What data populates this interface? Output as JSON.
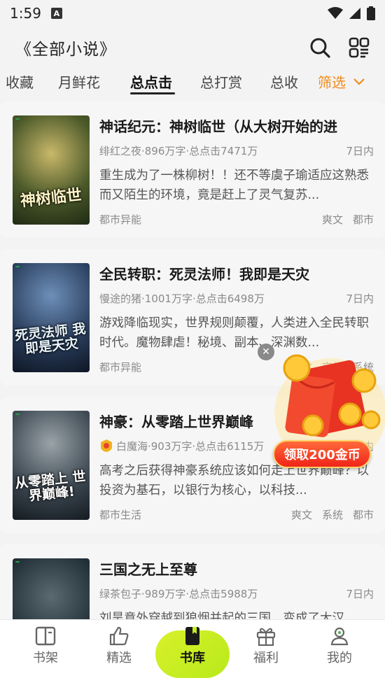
{
  "status_bar": {
    "time": "1:59",
    "notification_icon": "A"
  },
  "header": {
    "title": "《全部小说》",
    "icons": [
      "search-icon",
      "scan-icon"
    ]
  },
  "tabs": [
    {
      "label": "收藏"
    },
    {
      "label": "月鲜花"
    },
    {
      "label": "总点击"
    },
    {
      "label": "总打赏"
    },
    {
      "label": "总收"
    }
  ],
  "active_tab": "总点击",
  "filter_label": "筛选",
  "books": [
    {
      "title": "神话纪元：神树临世（从大树开始的进",
      "meta": "绯红之夜·896万字·总点击7471万",
      "time": "7日内",
      "desc": "重生成为了一株柳树！！还不等虞子瑜适应这熟悉而又陌生的环境，竟是赶上了灵气复苏...",
      "category": "都市异能",
      "tags": [
        "爽文",
        "都市"
      ],
      "cover_text": "神树临世"
    },
    {
      "title": "全民转职：死灵法师！我即是天灾",
      "meta": "慢途的猪·1001万字·总点击6498万",
      "time": "7日内",
      "desc": "游戏降临现实，世界规则颠覆，人类进入全民转职时代。魔物肆虐！秘境、副本、深渊数...",
      "category": "都市异能",
      "tags": [
        "爽文",
        "穿越",
        "系统"
      ],
      "cover_text": "死灵法师 我即是天灾"
    },
    {
      "title": "神豪：从零踏上世界巅峰",
      "meta": "白魔海·903万字·总点击6115万",
      "time": "7日内",
      "desc": "高考之后获得神豪系统应该如何走上世界巅峰？以投资为基石，以银行为核心，以科技...",
      "category": "都市生活",
      "tags": [
        "爽文",
        "系统",
        "都市"
      ],
      "cover_text": "从零踏上 世界巅峰!"
    },
    {
      "title": "三国之无上至尊",
      "meta": "绿茶包子·989万字·总点击5988万",
      "time": "7日内",
      "desc": "刘昊意外穿越到狼烟并起的三国，变成了大汉...",
      "category": "",
      "tags": [],
      "cover_text": ""
    }
  ],
  "promo": {
    "button_label": "领取200金币"
  },
  "bottom_nav": [
    {
      "label": "书架",
      "icon": "bookshelf-icon"
    },
    {
      "label": "精选",
      "icon": "thumbs-up-icon"
    },
    {
      "label": "书库",
      "icon": "library-icon"
    },
    {
      "label": "福利",
      "icon": "gift-icon"
    },
    {
      "label": "我的",
      "icon": "profile-icon"
    }
  ],
  "colors": {
    "accent": "#f08a1c",
    "nav_active": "#c6ed22",
    "promo_red": "#f02418"
  }
}
